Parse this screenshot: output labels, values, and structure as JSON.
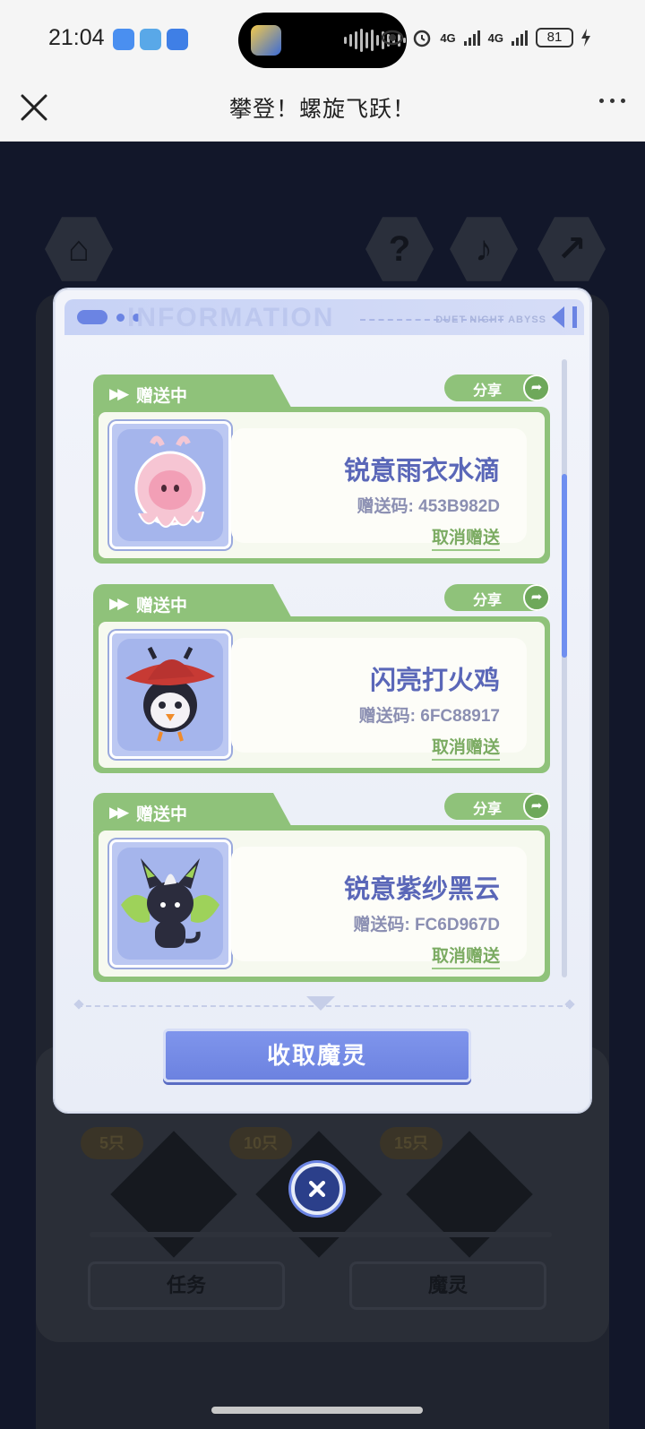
{
  "status_bar": {
    "time": "21:04",
    "network_1": "4G",
    "network_2": "4G",
    "battery": "81",
    "icons": [
      "message-icon",
      "weather-icon",
      "security-icon",
      "eye-icon",
      "alarm-icon",
      "signal-icon",
      "charging-icon"
    ]
  },
  "title_bar": {
    "title": "攀登！螺旋飞跃！",
    "close_icon": "close-icon",
    "more_icon": "more-icon"
  },
  "background": {
    "badges": [
      "5只",
      "10只",
      "15只"
    ],
    "tabs": [
      "任务",
      "魔灵"
    ]
  },
  "modal": {
    "header_label": "DUET NIGHT ABYSS",
    "header_watermark": "INFORMATION",
    "cards": [
      {
        "status": "赠送中",
        "share_label": "分享",
        "name": "锐意雨衣水滴",
        "code": "赠送码: 453B982D",
        "cancel_label": "取消赠送"
      },
      {
        "status": "赠送中",
        "share_label": "分享",
        "name": "闪亮打火鸡",
        "code": "赠送码: 6FC88917",
        "cancel_label": "取消赠送"
      },
      {
        "status": "赠送中",
        "share_label": "分享",
        "name": "锐意紫纱黑云",
        "code": "赠送码: FC6D967D",
        "cancel_label": "取消赠送"
      }
    ],
    "collect_button": "收取魔灵"
  },
  "colors": {
    "accent": "#6c82e0",
    "card_green": "#8fc27a",
    "name_text": "#5a67b8"
  }
}
